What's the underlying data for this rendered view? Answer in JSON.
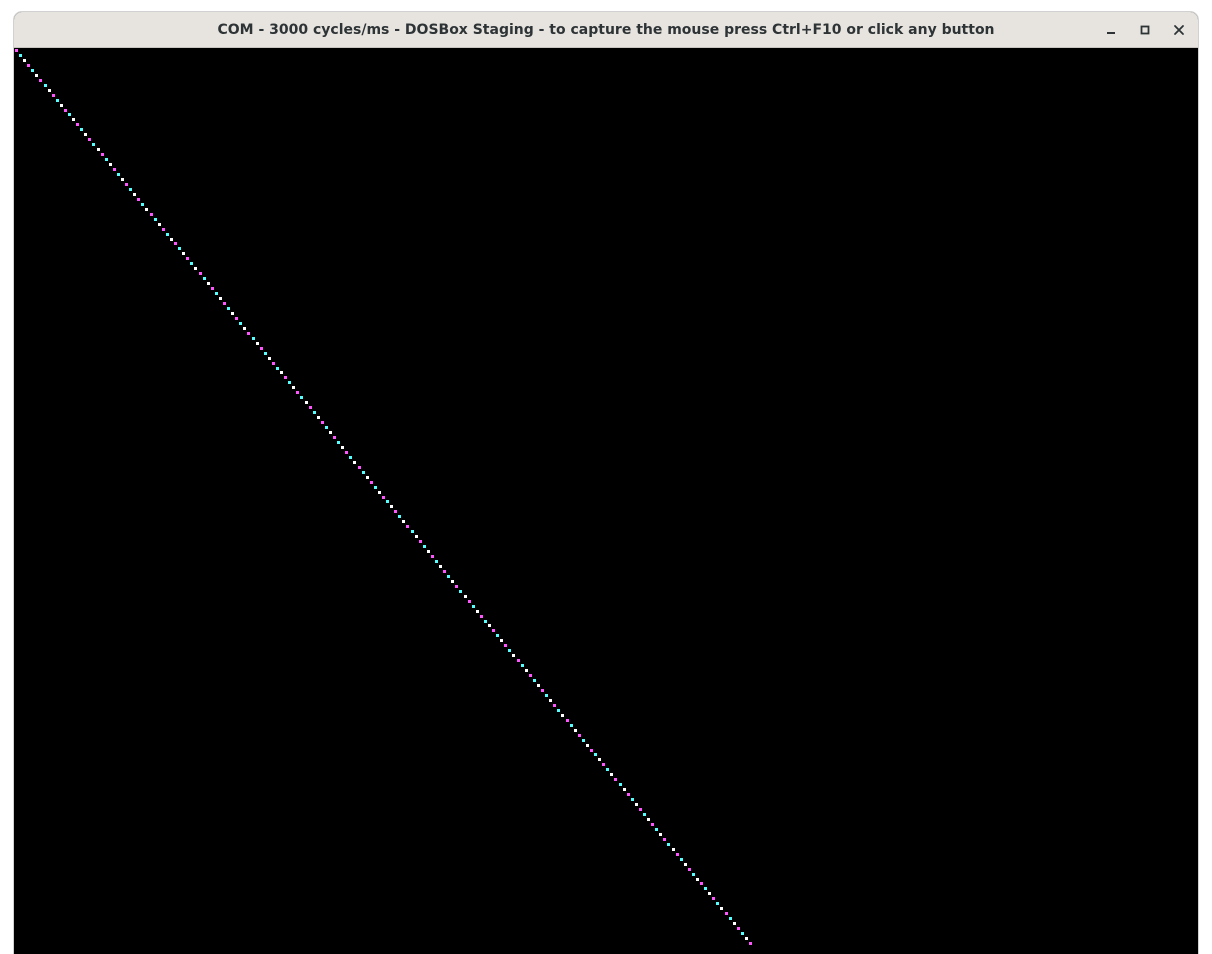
{
  "window": {
    "title": "COM - 3000 cycles/ms - DOSBox Staging - to capture the mouse press Ctrl+F10 or click any button"
  },
  "controls": {
    "minimize_icon": "minimize-icon",
    "maximize_icon": "maximize-icon",
    "close_icon": "close-icon"
  },
  "screen": {
    "background": "#000000",
    "line_palette": [
      "#ff55ff",
      "#55ffff",
      "#ffffff"
    ]
  }
}
